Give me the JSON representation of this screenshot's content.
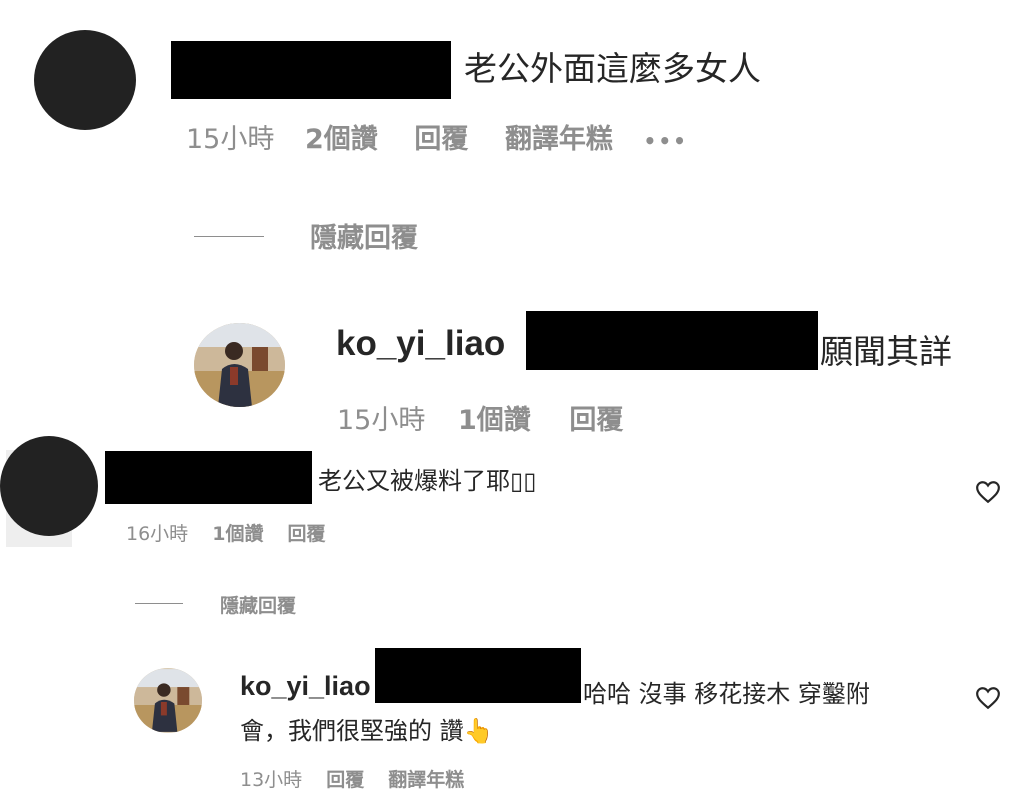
{
  "colors": {
    "text": "#262626",
    "meta": "#8e8e8e",
    "redaction": "#000000"
  },
  "comment_1": {
    "text": "老公外面這麼多女人",
    "time": "15小時",
    "likes": "2個讚",
    "reply": "回覆",
    "translate": "翻譯年糕",
    "more": "•••"
  },
  "hide_replies_1": "隱藏回覆",
  "reply_1": {
    "username": "ko_yi_liao",
    "text": "願聞其詳",
    "time": "15小時",
    "likes": "1個讚",
    "reply": "回覆"
  },
  "comment_2": {
    "text": "老公又被爆料了耶▯▯",
    "time": "16小時",
    "likes": "1個讚",
    "reply": "回覆",
    "like_icon": "heart-outline-icon"
  },
  "hide_replies_2": "隱藏回覆",
  "reply_2": {
    "username": "ko_yi_liao",
    "text_line1": "哈哈 沒事 移花接木 穿鑿附",
    "text_line2": "會，我們很堅強的 讚👆",
    "time": "13小時",
    "reply": "回覆",
    "translate": "翻譯年糕",
    "like_icon": "heart-outline-icon"
  }
}
